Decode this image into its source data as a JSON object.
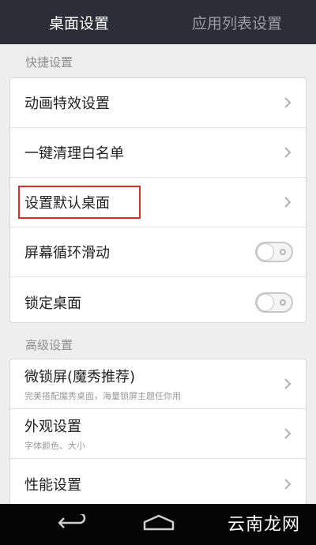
{
  "tabs": [
    {
      "label": "桌面设置",
      "active": true
    },
    {
      "label": "应用列表设置",
      "active": false
    }
  ],
  "sections": [
    {
      "header": "快捷设置",
      "rows": [
        {
          "label": "动画特效设置",
          "control": "chevron"
        },
        {
          "label": "一键清理白名单",
          "control": "chevron"
        },
        {
          "label": "设置默认桌面",
          "control": "chevron",
          "highlighted": true
        },
        {
          "label": "屏幕循环滑动",
          "control": "toggle",
          "on": false
        },
        {
          "label": "锁定桌面",
          "control": "toggle",
          "on": false
        }
      ]
    },
    {
      "header": "高级设置",
      "rows": [
        {
          "label": "微锁屏(魔秀推荐)",
          "sublabel": "完美搭配魔秀桌面，海量锁屏主题任你用",
          "control": "chevron"
        },
        {
          "label": "外观设置",
          "sublabel": "字体颜色、大小",
          "control": "chevron"
        },
        {
          "label": "性能设置",
          "control": "chevron"
        }
      ]
    }
  ],
  "navbar": {
    "back_icon": "back-arrow-icon",
    "home_icon": "home-icon"
  },
  "watermark": "云南龙网",
  "colors": {
    "tabbar_bg": "#2b2e36",
    "highlight_border": "#d32f2f",
    "page_bg": "#eeeeee"
  }
}
